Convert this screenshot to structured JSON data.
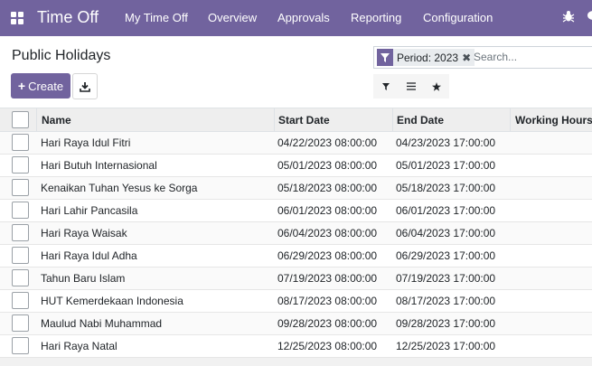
{
  "navbar": {
    "app_name": "Time Off",
    "menus": [
      "My Time Off",
      "Overview",
      "Approvals",
      "Reporting",
      "Configuration"
    ],
    "icons": [
      "apps-grid-icon",
      "bug-icon",
      "chat-icon"
    ],
    "color": "#71639e"
  },
  "page": {
    "title": "Public Holidays"
  },
  "toolbar": {
    "create_label": "Create",
    "download_icon": "download-icon"
  },
  "search": {
    "facet_label": "Period: 2023",
    "facet_icon": "filter-icon",
    "remove_glyph": "✖",
    "placeholder": "Search..."
  },
  "view_toggles": [
    "filter-icon",
    "group-by-icon",
    "favorite-star-icon"
  ],
  "table": {
    "columns": [
      "Name",
      "Start Date",
      "End Date",
      "Working Hours"
    ],
    "rows": [
      {
        "name": "Hari Raya Idul Fitri",
        "start": "04/22/2023 08:00:00",
        "end": "04/23/2023 17:00:00"
      },
      {
        "name": "Hari Butuh Internasional",
        "start": "05/01/2023 08:00:00",
        "end": "05/01/2023 17:00:00"
      },
      {
        "name": "Kenaikan Tuhan Yesus ke Sorga",
        "start": "05/18/2023 08:00:00",
        "end": "05/18/2023 17:00:00"
      },
      {
        "name": "Hari Lahir Pancasila",
        "start": "06/01/2023 08:00:00",
        "end": "06/01/2023 17:00:00"
      },
      {
        "name": "Hari Raya Waisak",
        "start": "06/04/2023 08:00:00",
        "end": "06/04/2023 17:00:00"
      },
      {
        "name": "Hari Raya Idul Adha",
        "start": "06/29/2023 08:00:00",
        "end": "06/29/2023 17:00:00"
      },
      {
        "name": "Tahun Baru Islam",
        "start": "07/19/2023 08:00:00",
        "end": "07/19/2023 17:00:00"
      },
      {
        "name": "HUT Kemerdekaan Indonesia",
        "start": "08/17/2023 08:00:00",
        "end": "08/17/2023 17:00:00"
      },
      {
        "name": "Maulud Nabi Muhammad",
        "start": "09/28/2023 08:00:00",
        "end": "09/28/2023 17:00:00"
      },
      {
        "name": "Hari Raya Natal",
        "start": "12/25/2023 08:00:00",
        "end": "12/25/2023 17:00:00"
      }
    ]
  }
}
